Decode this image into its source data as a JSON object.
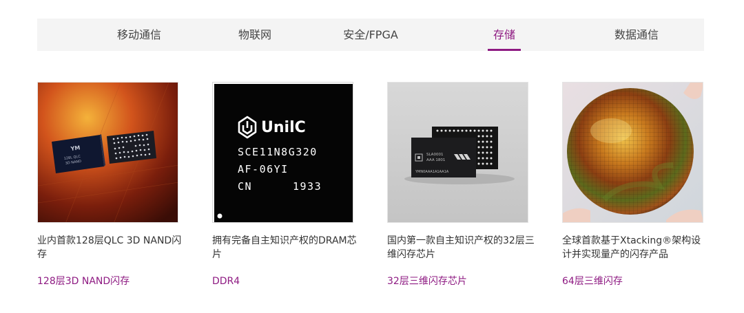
{
  "tabs": [
    {
      "label": "移动通信",
      "active": false
    },
    {
      "label": "物联网",
      "active": false
    },
    {
      "label": "安全/FPGA",
      "active": false
    },
    {
      "label": "存储",
      "active": true
    },
    {
      "label": "数据通信",
      "active": false
    }
  ],
  "accent_color": "#8e1a82",
  "cards": [
    {
      "image_icon": "qlc-nand-chip-image",
      "chip_text": [
        "128L QLC",
        "3D NAND"
      ],
      "description": "业内首款128层QLC 3D NAND闪存",
      "tag": "128层3D NAND闪存"
    },
    {
      "image_icon": "unilc-dram-chip-image",
      "chip_brand": "UnilC",
      "chip_lines": [
        "SCE11N8G320",
        "AF-06YI",
        "CN",
        "1933"
      ],
      "description": "拥有完备自主知识产权的DRAM芯片",
      "tag": "DDR4"
    },
    {
      "image_icon": "32-layer-nand-chip-image",
      "chip_lines": [
        "SLA0001",
        "AAA 1801",
        "YMN0AAA1A1AA1A"
      ],
      "description": "国内第一款自主知识产权的32层三维闪存芯片",
      "tag": "32层三维闪存芯片"
    },
    {
      "image_icon": "xtacking-wafer-image",
      "description": "全球首款基于Xtacking®架构设计并实现量产的闪存产品",
      "tag": "64层三维闪存"
    }
  ]
}
